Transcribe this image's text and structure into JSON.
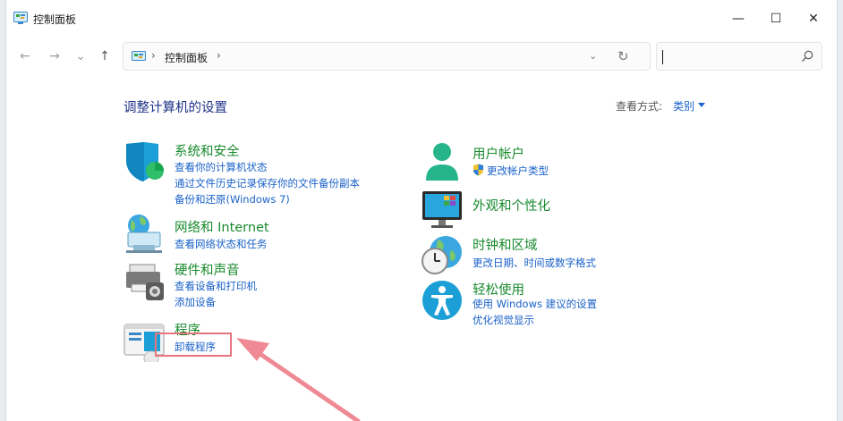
{
  "window": {
    "title": "控制面板",
    "minimize": "—",
    "maximize": "☐",
    "close": "✕"
  },
  "address": {
    "back": "←",
    "forward": "→",
    "recent": "⌄",
    "up": "↑",
    "sep1": "›",
    "location": "控制面板",
    "sep2": "›",
    "dropdown": "⌄",
    "refresh": "↻"
  },
  "search": {
    "value": ""
  },
  "main": {
    "heading": "调整计算机的设置",
    "view_label": "查看方式:",
    "view_value": "类别"
  },
  "categories": {
    "system": {
      "title": "系统和安全",
      "links": [
        "查看你的计算机状态",
        "通过文件历史记录保存你的文件备份副本",
        "备份和还原(Windows 7)"
      ]
    },
    "network": {
      "title": "网络和 Internet",
      "links": [
        "查看网络状态和任务"
      ]
    },
    "hardware": {
      "title": "硬件和声音",
      "links": [
        "查看设备和打印机",
        "添加设备"
      ]
    },
    "programs": {
      "title": "程序",
      "links": [
        "卸载程序"
      ]
    },
    "accounts": {
      "title": "用户帐户",
      "links": [
        "更改帐户类型"
      ]
    },
    "appearance": {
      "title": "外观和个性化",
      "links": []
    },
    "clock": {
      "title": "时钟和区域",
      "links": [
        "更改日期、时间或数字格式"
      ]
    },
    "ease": {
      "title": "轻松使用",
      "links": [
        "使用 Windows 建议的设置",
        "优化视觉显示"
      ]
    }
  },
  "colors": {
    "category_title": "#188a2d",
    "link": "#1a62c9",
    "heading": "#1e3287",
    "annotation": "#e8747e"
  }
}
